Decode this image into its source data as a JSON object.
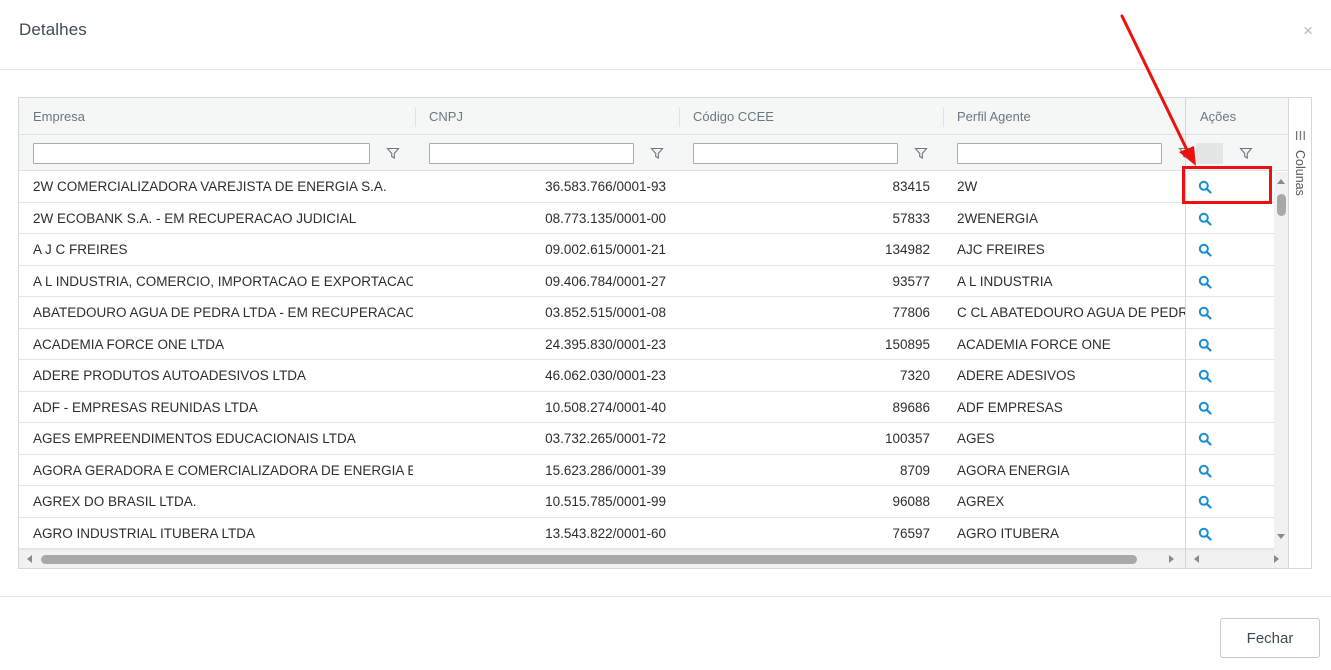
{
  "modal": {
    "title": "Detalhes",
    "close_glyph": "×",
    "close_button_label": "Fechar"
  },
  "grid": {
    "columns": [
      "Empresa",
      "CNPJ",
      "Código CCEE",
      "Perfil Agente",
      "Ações"
    ],
    "tool_panel_label": "Colunas",
    "filter_icon": "filter-funnel-icon",
    "action_icon": "search-icon",
    "rows": [
      {
        "empresa": "2W COMERCIALIZADORA VAREJISTA DE ENERGIA S.A.",
        "cnpj": "36.583.766/0001-93",
        "codigo": "83415",
        "perfil": "2W"
      },
      {
        "empresa": "2W ECOBANK S.A. - EM RECUPERACAO JUDICIAL",
        "cnpj": "08.773.135/0001-00",
        "codigo": "57833",
        "perfil": "2WENERGIA"
      },
      {
        "empresa": "A J C FREIRES",
        "cnpj": "09.002.615/0001-21",
        "codigo": "134982",
        "perfil": "AJC FREIRES"
      },
      {
        "empresa": "A L INDUSTRIA, COMERCIO, IMPORTACAO E EXPORTACAO ...",
        "cnpj": "09.406.784/0001-27",
        "codigo": "93577",
        "perfil": "A L INDUSTRIA"
      },
      {
        "empresa": "ABATEDOURO AGUA DE PEDRA LTDA - EM RECUPERACAO J...",
        "cnpj": "03.852.515/0001-08",
        "codigo": "77806",
        "perfil": "C CL ABATEDOURO AGUA DE PEDRA"
      },
      {
        "empresa": "ACADEMIA FORCE ONE LTDA",
        "cnpj": "24.395.830/0001-23",
        "codigo": "150895",
        "perfil": "ACADEMIA FORCE ONE"
      },
      {
        "empresa": "ADERE PRODUTOS AUTOADESIVOS LTDA",
        "cnpj": "46.062.030/0001-23",
        "codigo": "7320",
        "perfil": "ADERE ADESIVOS"
      },
      {
        "empresa": "ADF - EMPRESAS REUNIDAS LTDA",
        "cnpj": "10.508.274/0001-40",
        "codigo": "89686",
        "perfil": "ADF EMPRESAS"
      },
      {
        "empresa": "AGES EMPREENDIMENTOS EDUCACIONAIS LTDA",
        "cnpj": "03.732.265/0001-72",
        "codigo": "100357",
        "perfil": "AGES"
      },
      {
        "empresa": "AGORA GERADORA E COMERCIALIZADORA DE ENERGIA EL...",
        "cnpj": "15.623.286/0001-39",
        "codigo": "8709",
        "perfil": "AGORA ENERGIA"
      },
      {
        "empresa": "AGREX DO BRASIL LTDA.",
        "cnpj": "10.515.785/0001-99",
        "codigo": "96088",
        "perfil": "AGREX"
      },
      {
        "empresa": "AGRO INDUSTRIAL ITUBERA LTDA",
        "cnpj": "13.543.822/0001-60",
        "codigo": "76597",
        "perfil": "AGRO ITUBERA"
      }
    ]
  },
  "colors": {
    "accent_icon": "#1a8fd1",
    "highlight": "#ee0f0f"
  }
}
